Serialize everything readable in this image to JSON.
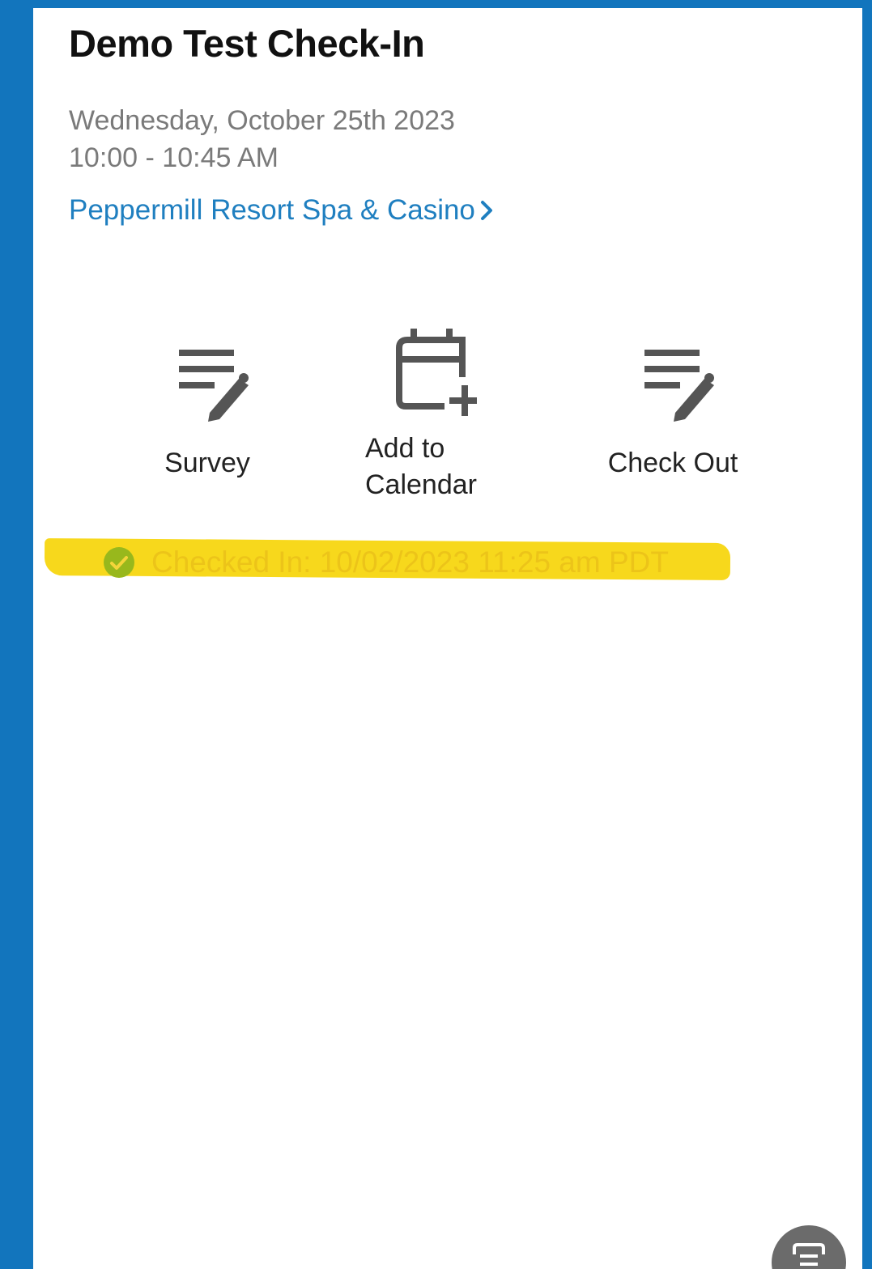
{
  "event": {
    "title": "Demo Test Check-In",
    "date": "Wednesday, October 25th 2023",
    "time": "10:00 - 10:45 AM",
    "venue": "Peppermill Resort Spa & Casino"
  },
  "actions": {
    "survey_label": "Survey",
    "calendar_label_line1": "Add to",
    "calendar_label_line2": "Calendar",
    "checkout_label": "Check Out"
  },
  "status": {
    "checked_in_text": "Checked In: 10/02/2023 11:25 am PDT"
  },
  "icons": {
    "survey": "edit-note-icon",
    "calendar": "calendar-add-icon",
    "checkout": "edit-note-icon",
    "checked": "check-circle-icon",
    "venue_chevron": "chevron-right-icon",
    "fab": "chat-icon"
  },
  "colors": {
    "background": "#1275bd",
    "link": "#1f7fc0",
    "highlight": "#f7d81c",
    "fab": "#6b6b6b"
  }
}
